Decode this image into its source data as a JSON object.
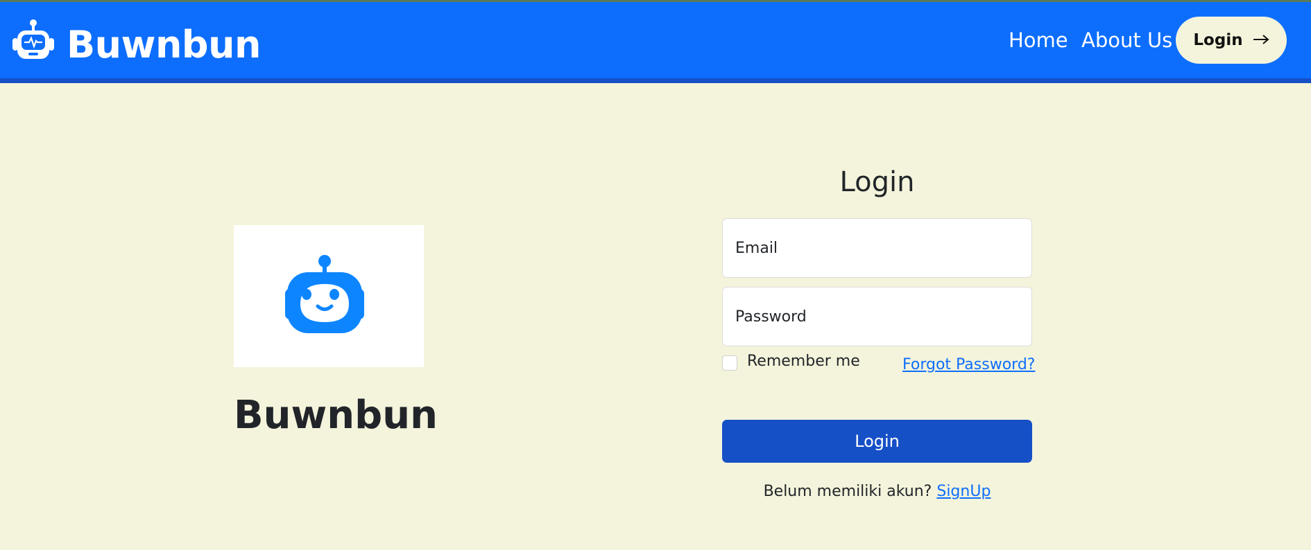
{
  "navbar": {
    "brand": "Buwnbun",
    "brand_icon": "robot-icon",
    "links": [
      {
        "label": "Home"
      },
      {
        "label": "About Us"
      }
    ],
    "login_label": "Login",
    "login_icon": "arrow-right-icon",
    "colors": {
      "background": "#0d6efd",
      "accent": "#f4f4dc"
    }
  },
  "hero": {
    "logo_icon": "robot-face-icon",
    "title": "Buwnbun"
  },
  "login_form": {
    "title": "Login",
    "email_placeholder": "Email",
    "password_placeholder": "Password",
    "remember_label": "Remember me",
    "forgot_label": "Forgot Password?",
    "submit_label": "Login",
    "signup_prompt": "Belum memiliki akun?",
    "signup_link": "SignUp",
    "colors": {
      "button": "#1650c7",
      "link": "#0d6efd"
    }
  }
}
